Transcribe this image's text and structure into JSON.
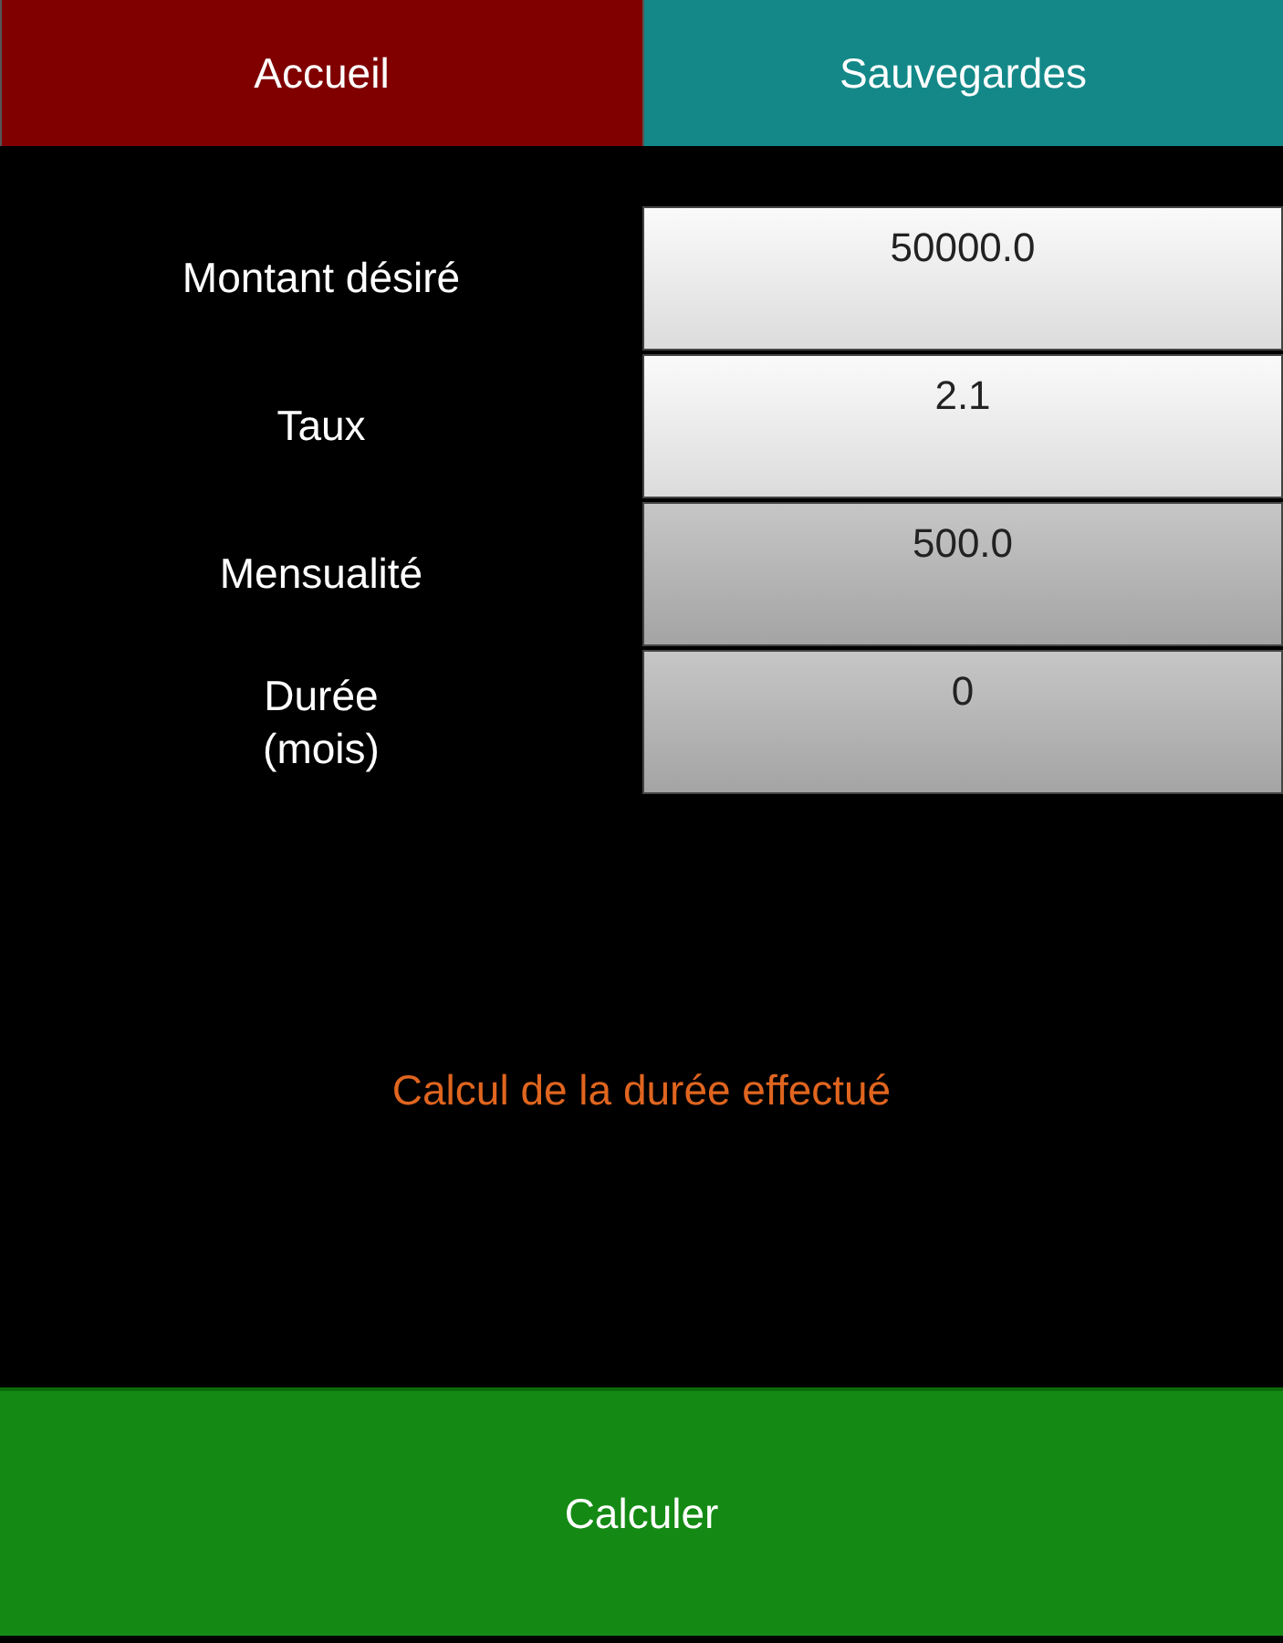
{
  "tabs": [
    {
      "label": "Accueil",
      "kind": "home"
    },
    {
      "label": "Sauvegardes",
      "kind": "saves"
    }
  ],
  "fields": [
    {
      "label": "Montant désiré",
      "value": "50000.0",
      "disabled": false
    },
    {
      "label": "Taux",
      "value": "2.1",
      "disabled": false
    },
    {
      "label": "Mensualité",
      "value": "500.0",
      "disabled": true
    },
    {
      "label": "Durée\n(mois)",
      "value": "0",
      "disabled": true
    }
  ],
  "status_message": "Calcul de la durée effectué",
  "action_button": "Calculer"
}
